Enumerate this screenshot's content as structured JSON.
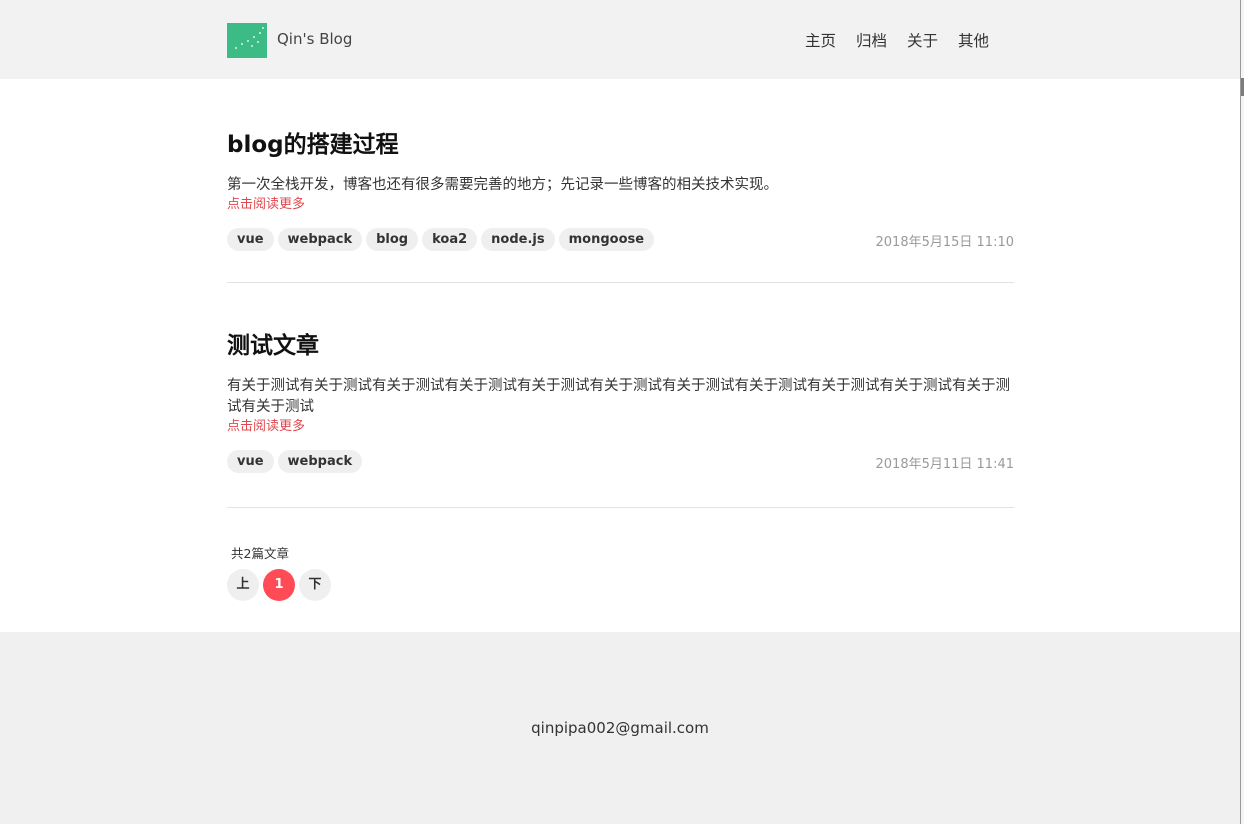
{
  "header": {
    "site_title": "Qin's Blog",
    "logo_icon": "constellation-logo-icon",
    "logo_color": "#3dbb86",
    "nav": [
      {
        "label": "主页"
      },
      {
        "label": "归档"
      },
      {
        "label": "关于"
      },
      {
        "label": "其他"
      }
    ]
  },
  "posts": [
    {
      "title": "blog的搭建过程",
      "summary": "第一次全栈开发，博客也还有很多需要完善的地方；先记录一些博客的相关技术实现。",
      "read_more": "点击阅读更多",
      "tags": [
        "vue",
        "webpack",
        "blog",
        "koa2",
        "node.js",
        "mongoose"
      ],
      "date": "2018年5月15日 11:10"
    },
    {
      "title": "测试文章",
      "summary": "有关于测试有关于测试有关于测试有关于测试有关于测试有关于测试有关于测试有关于测试有关于测试有关于测试有关于测试有关于测试",
      "read_more": "点击阅读更多",
      "tags": [
        "vue",
        "webpack"
      ],
      "date": "2018年5月11日 11:41"
    }
  ],
  "pagination": {
    "total_label": "共2篇文章",
    "prev_label": "上",
    "current_page": "1",
    "next_label": "下",
    "active_color": "#ff4b55"
  },
  "footer": {
    "email": "qinpipa002@gmail.com"
  },
  "colors": {
    "read_more": "#e0484e",
    "header_bg": "#f2f2f2",
    "content_bg": "#ffffff"
  }
}
